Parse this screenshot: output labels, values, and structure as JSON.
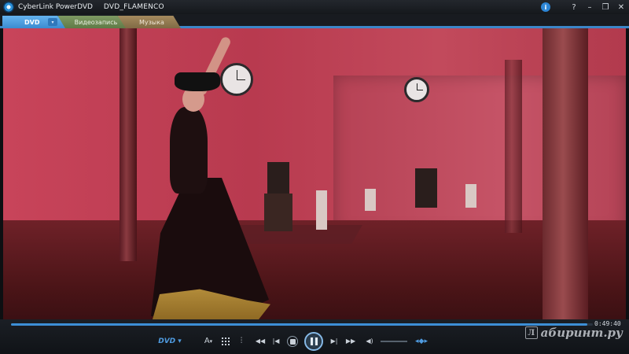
{
  "window": {
    "app_name": "CyberLink PowerDVD",
    "document_title": "DVD_FLAMENCO",
    "controls": {
      "info_label": "i",
      "help_label": "?",
      "minimize_label": "–",
      "restore_label": "❐",
      "close_label": "✕"
    }
  },
  "tabs": [
    {
      "label": "DVD",
      "active": true,
      "dropdown_label": "▾"
    },
    {
      "label": "Видеозапись",
      "active": false
    },
    {
      "label": "Музыка",
      "active": false
    }
  ],
  "playback": {
    "elapsed_time": "0:49:40",
    "progress_fraction": 0.99,
    "source_label": "DVD ▾",
    "volume_fraction": 0.5
  },
  "controls": {
    "audio_label": "A",
    "menu_label": "▾",
    "settings_label": "⫶",
    "rewind_label": "◀◀",
    "prev_label": "|◀",
    "next_label": "▶|",
    "forward_label": "▶▶",
    "volume_label": "◀)",
    "threed_label": "◂◆▸"
  },
  "watermark": {
    "mark_label": "Л",
    "text": "абиринт.ру"
  },
  "colors": {
    "accent": "#3d8fd6",
    "tab_dvd": "#4f9fe2",
    "tab_video": "#6e8a55",
    "tab_music": "#937852"
  }
}
